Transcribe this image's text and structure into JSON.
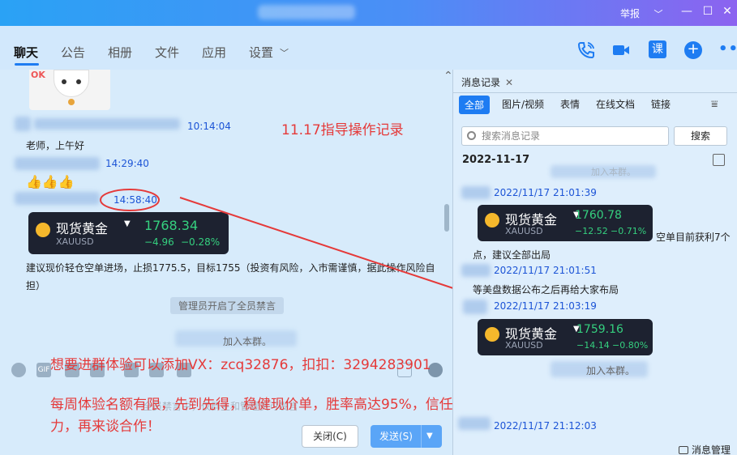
{
  "titlebar": {
    "report": "举报",
    "chevron": "chevron-down-icon",
    "minimize": "—",
    "maximize": "☐",
    "close": "✕"
  },
  "tabs": [
    {
      "label": "聊天",
      "active": true
    },
    {
      "label": "公告",
      "active": false
    },
    {
      "label": "相册",
      "active": false
    },
    {
      "label": "文件",
      "active": false
    },
    {
      "label": "应用",
      "active": false
    },
    {
      "label": "设置",
      "active": false
    }
  ],
  "toolbar_icons": [
    "phone-icon",
    "video-icon",
    "lesson-icon",
    "add-icon",
    "more-icon"
  ],
  "lesson_label": "课",
  "chat": {
    "sticker_text": "OK",
    "messages": [
      {
        "time": "10:14:04",
        "text": "老师，上午好"
      },
      {
        "time": "14:29:40",
        "text": "👍👍👍"
      },
      {
        "time": "14:58:40",
        "text": "建议现价轻仓空单进场，止损1775.5，目标1755（投资有风险，入市需谨慎，据此操作风险自担）"
      }
    ],
    "gold_card": {
      "name": "现货黄金",
      "symbol": "XAUUSD",
      "price": "1768.34",
      "change": "−4.96",
      "change_pct": "−0.28%"
    },
    "system_msgs": [
      "管理员开启了全员禁言",
      "加入本群。"
    ],
    "overlay_title": "11.17指导操作记录",
    "overlay_contact": "想要进群体验可以添加VX：zcq32876，扣扣：3294283901",
    "overlay_promo": "每周体验名额有限，先到先得，稳健现价单，胜率高达95%，信任是基础，实力才是关键！张彦溱秉承先体验实力，再来谈合作！",
    "input_placeholder": "全员禁言中，仅群主和管理员可发言"
  },
  "buttons": {
    "close": "关闭(C)",
    "send": "发送(S)"
  },
  "history": {
    "tab_label": "消息记录",
    "filters": [
      "全部",
      "图片/视频",
      "表情",
      "在线文档",
      "链接"
    ],
    "search_placeholder": "搜索消息记录",
    "search_button": "搜索",
    "date": "2022-11-17",
    "faded_join": "加入本群。",
    "entries": [
      {
        "time": "2022/11/17 21:01:39"
      },
      {
        "time": "2022/11/17 21:01:51",
        "text_before": "点，建议全部出局",
        "text": "等美盘数据公布之后再给大家布局"
      },
      {
        "time": "2022/11/17 21:03:19"
      },
      {
        "time": "2022/11/17 21:12:03"
      }
    ],
    "side_text": "空单目前获利7个",
    "gold_card_1": {
      "name": "现货黄金",
      "symbol": "XAUUSD",
      "price": "1760.78",
      "change": "−12.52",
      "change_pct": "−0.71%"
    },
    "gold_card_2": {
      "name": "现货黄金",
      "symbol": "XAUUSD",
      "price": "1759.16",
      "change": "−14.14",
      "change_pct": "−0.80%"
    },
    "join_msg": "加入本群。",
    "bottom_link": "消息管理"
  }
}
